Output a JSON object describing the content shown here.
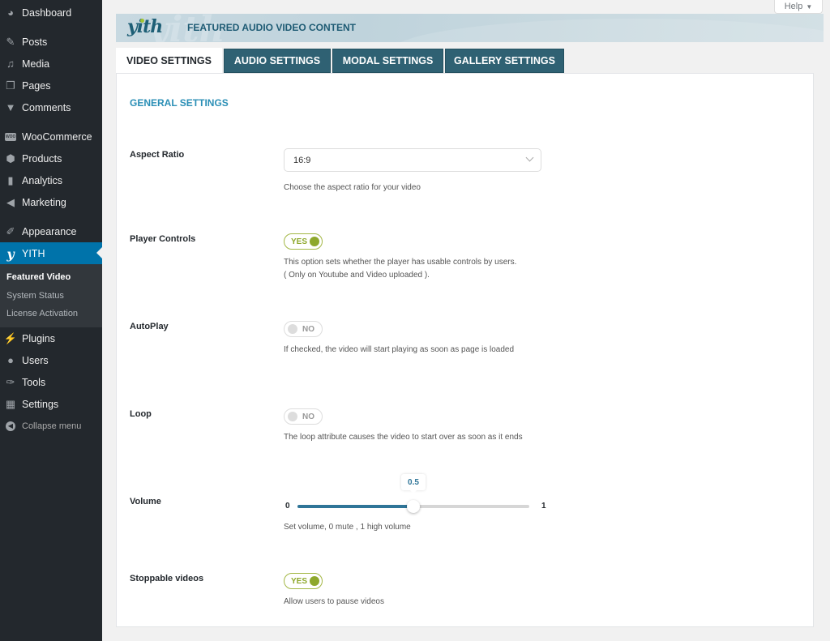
{
  "sidebar": {
    "items": [
      {
        "label": "Dashboard",
        "icon": "dashboard-icon"
      },
      {
        "label": "Posts",
        "icon": "pin-icon"
      },
      {
        "label": "Media",
        "icon": "media-icon"
      },
      {
        "label": "Pages",
        "icon": "pages-icon"
      },
      {
        "label": "Comments",
        "icon": "comment-icon"
      },
      {
        "label": "WooCommerce",
        "icon": "woo-icon"
      },
      {
        "label": "Products",
        "icon": "box-icon"
      },
      {
        "label": "Analytics",
        "icon": "bar-chart-icon"
      },
      {
        "label": "Marketing",
        "icon": "megaphone-icon"
      },
      {
        "label": "Appearance",
        "icon": "brush-icon"
      },
      {
        "label": "YITH",
        "icon": "yith-icon"
      },
      {
        "label": "Plugins",
        "icon": "plug-icon"
      },
      {
        "label": "Users",
        "icon": "user-icon"
      },
      {
        "label": "Tools",
        "icon": "wrench-icon"
      },
      {
        "label": "Settings",
        "icon": "sliders-icon"
      },
      {
        "label": "Collapse menu",
        "icon": "collapse-icon"
      }
    ],
    "submenu": [
      {
        "label": "Featured Video"
      },
      {
        "label": "System Status"
      },
      {
        "label": "License Activation"
      }
    ]
  },
  "help": {
    "label": "Help"
  },
  "banner": {
    "logo": "yith",
    "title": "FEATURED AUDIO VIDEO CONTENT"
  },
  "tabs": [
    {
      "label": "VIDEO SETTINGS"
    },
    {
      "label": "AUDIO SETTINGS"
    },
    {
      "label": "MODAL SETTINGS"
    },
    {
      "label": "GALLERY SETTINGS"
    }
  ],
  "section_title": "GENERAL SETTINGS",
  "fields": {
    "aspect_ratio": {
      "label": "Aspect Ratio",
      "value": "16:9",
      "desc": "Choose the aspect ratio for your video"
    },
    "player_controls": {
      "label": "Player Controls",
      "state": "YES",
      "desc": "This option sets whether the player has usable controls by users. ( Only on Youtube and Video uploaded )."
    },
    "autoplay": {
      "label": "AutoPlay",
      "state": "NO",
      "desc": "If checked, the video will start playing as soon as page is loaded"
    },
    "loop": {
      "label": "Loop",
      "state": "NO",
      "desc": "The loop attribute causes the video to start over as soon as it ends"
    },
    "volume": {
      "label": "Volume",
      "min": "0",
      "max": "1",
      "value": 0.5,
      "value_label": "0.5",
      "desc": "Set volume, 0 mute , 1 high volume"
    },
    "stoppable": {
      "label": "Stoppable videos",
      "state": "YES",
      "desc": "Allow users to pause videos"
    }
  },
  "colors": {
    "accent": "#0073aa",
    "toggle_on": "#8ea82c",
    "tab_bg": "#2f6173",
    "slider": "#2f7598"
  }
}
